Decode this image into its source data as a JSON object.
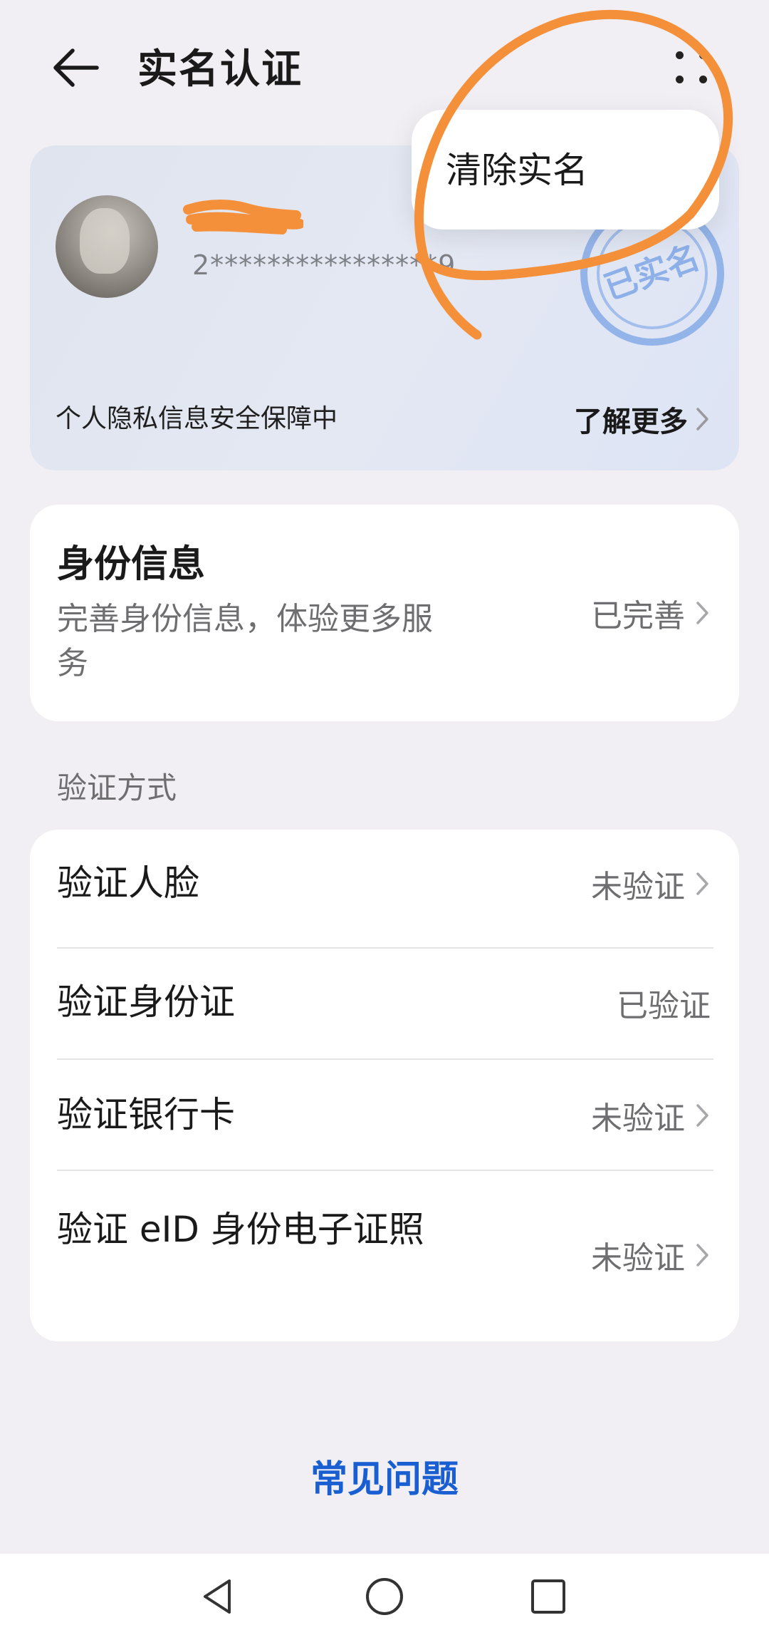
{
  "header": {
    "title": "实名认证",
    "back_icon": "arrow-left-icon",
    "more_icon": "more-dots-icon"
  },
  "id_card": {
    "masked_id": "2****************9",
    "privacy_text": "个人隐私信息安全保障中",
    "learn_more_label": "了解更多",
    "stamp_text": "已实名",
    "stamp_color": "#6f9be0",
    "background_color": "#e2e7f2"
  },
  "popup_menu": {
    "items": [
      {
        "label": "清除实名"
      }
    ]
  },
  "identity_info": {
    "title": "身份信息",
    "description": "完善身份信息，体验更多服务",
    "status": "已完善"
  },
  "verification": {
    "section_title": "验证方式",
    "items": [
      {
        "label": "验证人脸",
        "status": "未验证",
        "has_chevron": true
      },
      {
        "label": "验证身份证",
        "status": "已验证",
        "has_chevron": false
      },
      {
        "label": "验证银行卡",
        "status": "未验证",
        "has_chevron": true
      },
      {
        "label": "验证 eID 身份电子证照",
        "status": "未验证",
        "has_chevron": true
      }
    ]
  },
  "faq": {
    "label": "常见问题",
    "color": "#1a5fd1"
  },
  "navbar": {
    "buttons": [
      "nav-back-icon",
      "nav-home-icon",
      "nav-recents-icon"
    ]
  },
  "annotation": {
    "color": "#f5903a"
  }
}
